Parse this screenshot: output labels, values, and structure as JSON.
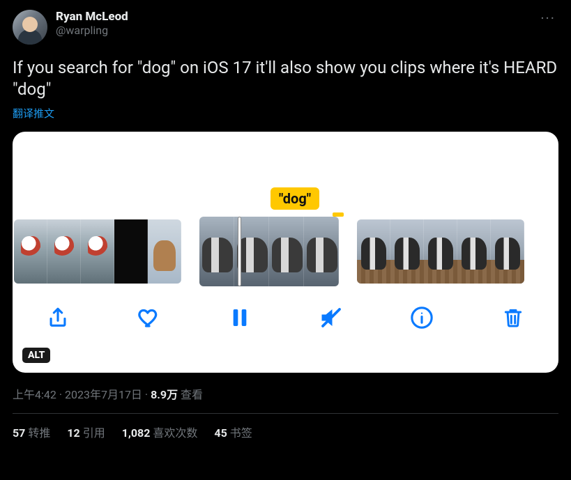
{
  "author": {
    "display_name": "Ryan McLeod",
    "handle": "@warpling"
  },
  "tweet_text": "If you search for \"dog\" on iOS 17 it'll also show you clips where it's HEARD \"dog\"",
  "translate_label": "翻译推文",
  "media": {
    "search_keyword_label": "\"dog\"",
    "alt_badge": "ALT"
  },
  "meta": {
    "time": "上午4:42",
    "dot1": " · ",
    "date": "2023年7月17日",
    "dot2": " · ",
    "views_count": "8.9万",
    "views_label": " 查看"
  },
  "stats": {
    "retweets": {
      "count": "57",
      "label": "转推"
    },
    "quotes": {
      "count": "12",
      "label": "引用"
    },
    "likes": {
      "count": "1,082",
      "label": "喜欢次数"
    },
    "bookmarks": {
      "count": "45",
      "label": "书签"
    }
  }
}
